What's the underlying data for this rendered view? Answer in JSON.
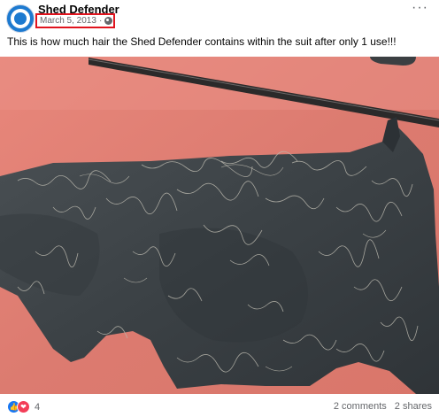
{
  "post": {
    "page_name": "Shed Defender",
    "date": "March 5, 2013",
    "separator": "·",
    "privacy_icon": "globe-icon",
    "more_label": "···",
    "caption": "This is how much hair the Shed Defender contains within the suit after only 1 use!!!"
  },
  "photo": {
    "subject": "dark grey dog bodysuit covered in shed hair on a salmon-coloured surface",
    "background_color": "#df7f73",
    "suit_color": "#3c4246"
  },
  "footer": {
    "reaction_icons": [
      "like-icon",
      "love-icon"
    ],
    "reaction_count": "4",
    "comments": "2 comments",
    "shares": "2 shares"
  },
  "colors": {
    "highlight_border": "#e0141e",
    "avatar_blue": "#1d7ad0",
    "meta_text": "#65676b"
  }
}
